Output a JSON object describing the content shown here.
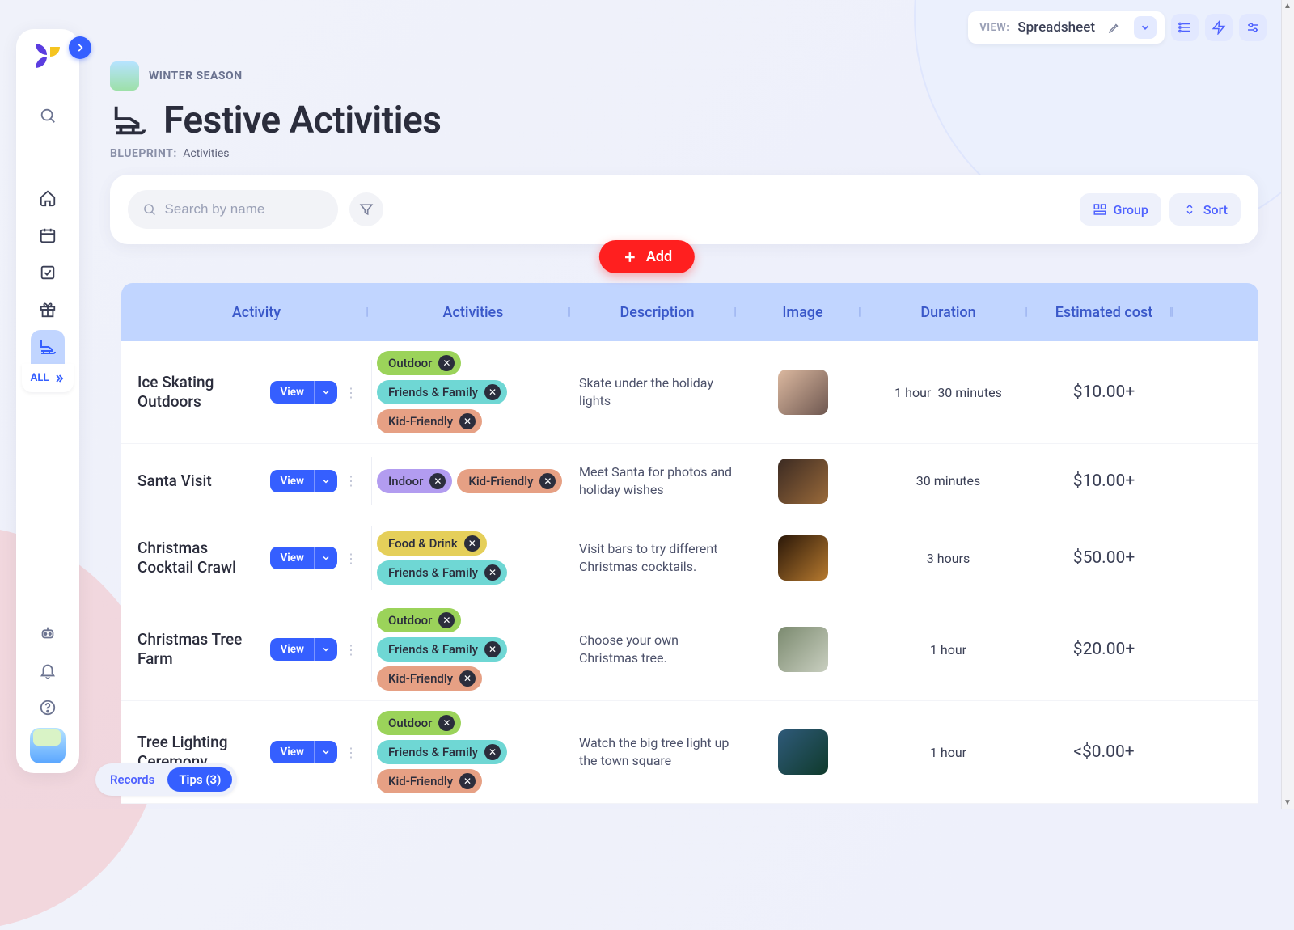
{
  "viewbar": {
    "label": "VIEW:",
    "value": "Spreadsheet"
  },
  "breadcrumb": "WINTER SEASON",
  "title": "Festive Activities",
  "blueprint_label": "BLUEPRINT:",
  "blueprint_value": "Activities",
  "search_placeholder": "Search by name",
  "group_label": "Group",
  "sort_label": "Sort",
  "add_label": "Add",
  "sidebar": {
    "all": "ALL"
  },
  "columns": {
    "activity": "Activity",
    "tags": "Activities",
    "desc": "Description",
    "image": "Image",
    "duration": "Duration",
    "cost": "Estimated cost"
  },
  "view_btn": "View",
  "tag_labels": {
    "outdoor": "Outdoor",
    "ff": "Friends & Family",
    "kid": "Kid-Friendly",
    "indoor": "Indoor",
    "food": "Food & Drink"
  },
  "rows": [
    {
      "title": "Ice Skating Outdoors",
      "desc": "Skate under the holiday lights",
      "duration_a": "1 hour",
      "duration_b": "30 minutes",
      "cost": "$10.00+",
      "img": "linear-gradient(135deg,#dcb9a0,#6e5750)"
    },
    {
      "title": "Santa Visit",
      "desc": "Meet Santa for photos and holiday wishes",
      "duration_a": "30 minutes",
      "duration_b": "",
      "cost": "$10.00+",
      "img": "linear-gradient(135deg,#3b2a22,#9a6a3a)"
    },
    {
      "title": "Christmas Cocktail Crawl",
      "desc": "Visit bars to try different Christmas cocktails.",
      "duration_a": "3 hours",
      "duration_b": "",
      "cost": "$50.00+",
      "img": "linear-gradient(135deg,#2a1708,#b77a2f)"
    },
    {
      "title": "Christmas Tree Farm",
      "desc": "Choose your own Christmas tree.",
      "duration_a": "1 hour",
      "duration_b": "",
      "cost": "$20.00+",
      "img": "linear-gradient(135deg,#7b8a6f,#c9cfc0)"
    },
    {
      "title": "Tree Lighting Ceremony",
      "desc": "Watch the big tree light up the town square",
      "duration_a": "1 hour",
      "duration_b": "",
      "cost": "<$0.00+",
      "img": "linear-gradient(135deg,#2f5a7a,#0f3a2b)"
    }
  ],
  "footer": {
    "records": "Records",
    "tips": "Tips (3)"
  }
}
